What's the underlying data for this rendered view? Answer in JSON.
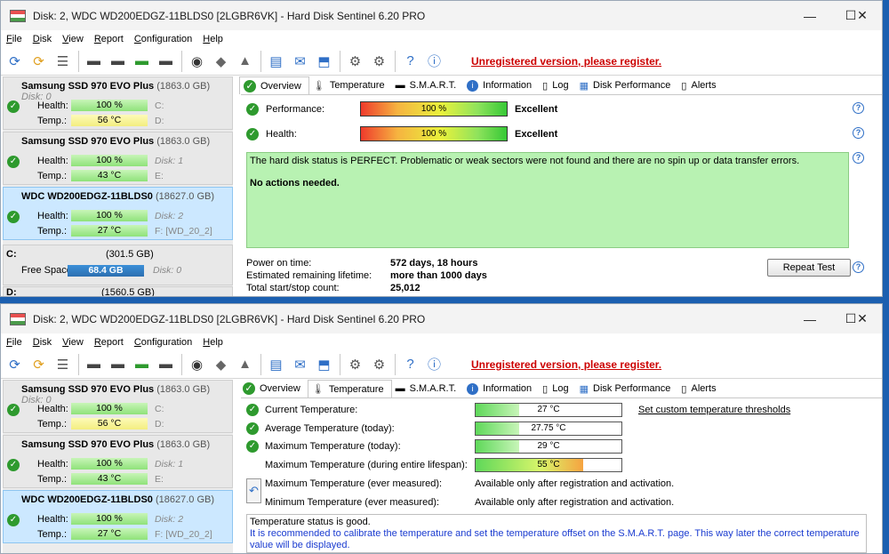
{
  "title": "Disk: 2, WDC WD200EDGZ-11BLDS0 [2LGBR6VK]  -  Hard Disk Sentinel 6.20 PRO",
  "window_controls": {
    "minimize": "—",
    "maximize": "☐",
    "close": "✕"
  },
  "menu": [
    "File",
    "Disk",
    "View",
    "Report",
    "Configuration",
    "Help"
  ],
  "unregistered": "Unregistered version, please register.",
  "disks": [
    {
      "name": "Samsung SSD 970 EVO Plus",
      "size": "(1863.0 GB)",
      "disk_label": "Disk: 0",
      "health_label": "Health:",
      "health": "100 %",
      "health_sub": "C:",
      "temp_label": "Temp.:",
      "temp": "56 °C",
      "temp_sub": "D:",
      "temp_color": "yellow"
    },
    {
      "name": "Samsung SSD 970 EVO Plus",
      "size": "(1863.0 GB)",
      "disk_label": "",
      "health_label": "Health:",
      "health": "100 %",
      "health_sub": "Disk: 1",
      "temp_label": "Temp.:",
      "temp": "43 °C",
      "temp_sub": "E:",
      "temp_color": "green"
    },
    {
      "name": "WDC WD200EDGZ-11BLDS0",
      "size": "(18627.0 GB)",
      "disk_label": "",
      "health_label": "Health:",
      "health": "100 %",
      "health_sub": "Disk: 2",
      "temp_label": "Temp.:",
      "temp": "27 °C",
      "temp_sub": "F: [WD_20_2]",
      "temp_color": "green"
    }
  ],
  "partition": {
    "drive": "C:",
    "size": "(301.5 GB)",
    "free_label": "Free Space",
    "free": "68.4 GB",
    "disk": "Disk: 0",
    "next_drive": "D:",
    "next_size": "(1560.5 GB)"
  },
  "tabs": [
    "Overview",
    "Temperature",
    "S.M.A.R.T.",
    "Information",
    "Log",
    "Disk Performance",
    "Alerts"
  ],
  "overview": {
    "performance_label": "Performance:",
    "performance": "100 %",
    "performance_rating": "Excellent",
    "health_label": "Health:",
    "health": "100 %",
    "health_rating": "Excellent",
    "status_line1": "The hard disk status is PERFECT. Problematic or weak sectors were not found and there are no spin up or data transfer errors.",
    "status_line2": "No actions needed.",
    "power_on_label": "Power on time:",
    "power_on": "572 days, 18 hours",
    "lifetime_label": "Estimated remaining lifetime:",
    "lifetime": "more than 1000 days",
    "startstop_label": "Total start/stop count:",
    "startstop": "25,012",
    "repeat_button": "Repeat Test"
  },
  "temperature": {
    "rows": [
      {
        "label": "Current Temperature:",
        "value": "27 °C",
        "fill": 0.3,
        "check": true
      },
      {
        "label": "Average Temperature (today):",
        "value": "27.75 °C",
        "fill": 0.3,
        "check": true
      },
      {
        "label": "Maximum Temperature (today):",
        "value": "29 °C",
        "fill": 0.3,
        "check": true
      },
      {
        "label": "Maximum Temperature (during entire lifespan):",
        "value": "55 °C",
        "fill": 0.74,
        "check": false,
        "hot": true
      }
    ],
    "threshold_link": "Set custom temperature thresholds",
    "ever_max_label": "Maximum Temperature (ever measured):",
    "ever_min_label": "Minimum Temperature (ever measured):",
    "ever_value": "Available only after registration and activation.",
    "status_good": "Temperature status is good.",
    "calibrate_note": "It is recommended to calibrate the temperature and set the temperature offset on the S.M.A.R.T. page. This way later the correct temperature value will be displayed."
  },
  "colors": {
    "accent_red": "#cc0000",
    "status_green": "#b8f2b2",
    "selection": "#cce8ff"
  }
}
